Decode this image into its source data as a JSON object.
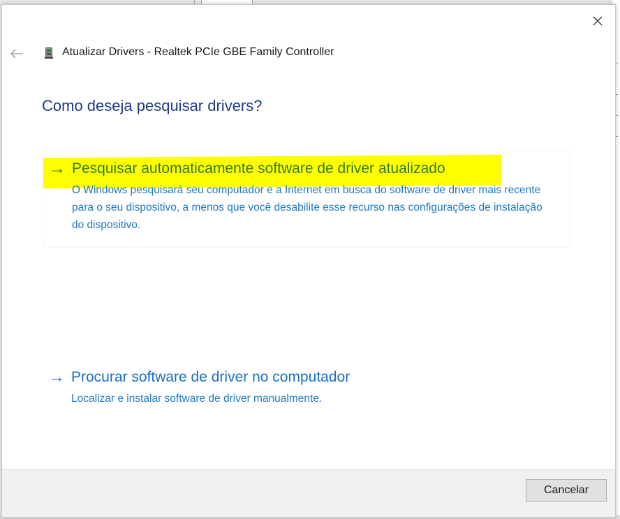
{
  "dialog": {
    "title": "Atualizar Drivers - Realtek PCIe GBE Family Controller",
    "heading": "Como deseja pesquisar drivers?",
    "options": [
      {
        "arrow": "→",
        "title": "Pesquisar automaticamente software de driver atualizado",
        "description": "O Windows pesquisará seu computador e a Internet em busca do software de driver mais recente para o seu dispositivo, a menos que você desabilite esse recurso nas configurações de instalação do dispositivo.",
        "highlighted": true,
        "highlight_color": "#ffff00"
      },
      {
        "arrow": "→",
        "title": "Procurar software de driver no computador",
        "description": "Localizar e instalar software de driver manualmente."
      }
    ],
    "footer": {
      "cancel_label": "Cancelar"
    }
  },
  "icons": {
    "back": "back-arrow-icon",
    "close": "close-icon",
    "device": "network-adapter-icon"
  },
  "colors": {
    "heading": "#1f3a8a",
    "link": "#1a6fc4",
    "highlight": "#ffff00"
  }
}
